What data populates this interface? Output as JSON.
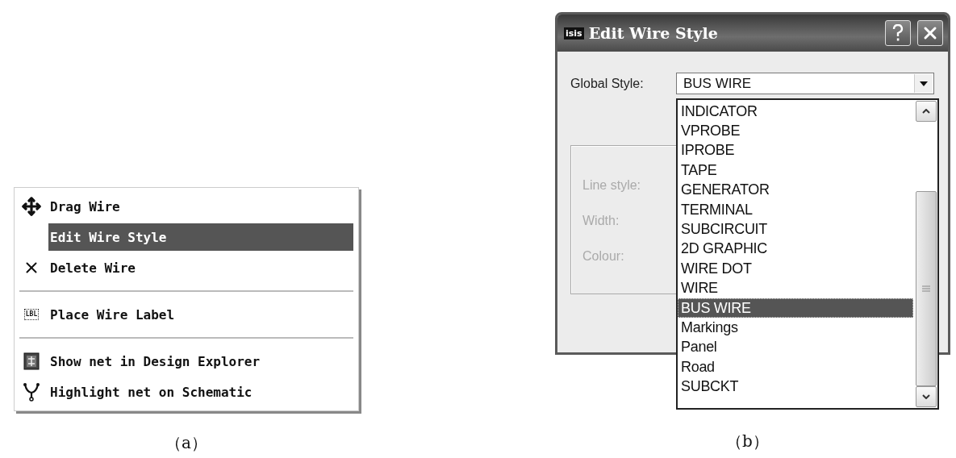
{
  "figure_a": {
    "menu": [
      {
        "kind": "item",
        "label": "Drag Wire",
        "selected": false
      },
      {
        "kind": "item",
        "label": "Edit Wire Style",
        "selected": true
      },
      {
        "kind": "item",
        "label": "Delete Wire",
        "selected": false
      },
      {
        "kind": "separator"
      },
      {
        "kind": "item",
        "label": "Place Wire Label",
        "selected": false,
        "badge": "LBL"
      },
      {
        "kind": "separator"
      },
      {
        "kind": "item",
        "label": "Show net in Design Explorer",
        "selected": false
      },
      {
        "kind": "item",
        "label": "Highlight net on Schematic",
        "selected": false
      }
    ],
    "caption": "（a）"
  },
  "figure_b": {
    "dialog": {
      "app_badge": "isis",
      "title": "Edit Wire Style",
      "global_style": {
        "label": "Global Style:",
        "value": "BUS WIRE"
      },
      "group": [
        {
          "label": "Line style:",
          "disabled": true
        },
        {
          "label": "Width:",
          "disabled": true
        },
        {
          "label": "Colour:",
          "disabled": true
        }
      ],
      "list": [
        {
          "label": "INDICATOR",
          "selected": false
        },
        {
          "label": "VPROBE",
          "selected": false
        },
        {
          "label": "IPROBE",
          "selected": false
        },
        {
          "label": "TAPE",
          "selected": false
        },
        {
          "label": "GENERATOR",
          "selected": false
        },
        {
          "label": "TERMINAL",
          "selected": false
        },
        {
          "label": "SUBCIRCUIT",
          "selected": false
        },
        {
          "label": "2D GRAPHIC",
          "selected": false
        },
        {
          "label": "WIRE DOT",
          "selected": false
        },
        {
          "label": "WIRE",
          "selected": false
        },
        {
          "label": "BUS WIRE",
          "selected": true
        },
        {
          "label": "Markings",
          "selected": false
        },
        {
          "label": "Panel",
          "selected": false
        },
        {
          "label": "Road",
          "selected": false
        },
        {
          "label": "SUBCKT",
          "selected": false
        }
      ]
    },
    "caption": "（b）"
  }
}
